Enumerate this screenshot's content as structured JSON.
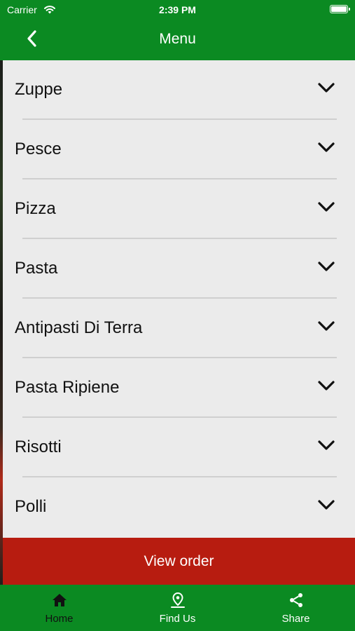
{
  "status_bar": {
    "carrier": "Carrier",
    "time": "2:39 PM"
  },
  "header": {
    "title": "Menu",
    "back_icon": "chevron-left-icon"
  },
  "menu_items": [
    {
      "label": "Zuppe"
    },
    {
      "label": "Pesce"
    },
    {
      "label": "Pizza"
    },
    {
      "label": "Pasta"
    },
    {
      "label": "Antipasti Di Terra"
    },
    {
      "label": "Pasta Ripiene"
    },
    {
      "label": "Risotti"
    },
    {
      "label": "Polli"
    }
  ],
  "view_order": {
    "label": "View order"
  },
  "tabs": [
    {
      "label": "Home",
      "icon": "home-icon"
    },
    {
      "label": "Find Us",
      "icon": "location-pin-icon"
    },
    {
      "label": "Share",
      "icon": "share-icon"
    }
  ],
  "colors": {
    "brand_green": "#0b8a22",
    "order_red": "#b71c10",
    "list_bg": "#ebebeb",
    "divider": "#cfcfcf"
  }
}
